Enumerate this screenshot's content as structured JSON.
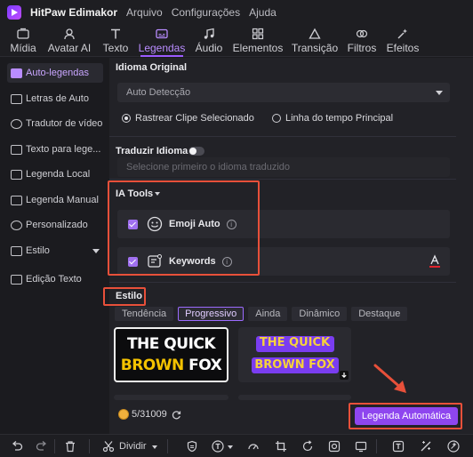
{
  "window": {
    "app_name": "HitPaw Edimakor",
    "menus": [
      "Arquivo",
      "Configurações",
      "Ajuda"
    ]
  },
  "toolbar": {
    "tools": [
      {
        "label": "Mídia",
        "icon": "media-icon",
        "active": false
      },
      {
        "label": "Avatar AI",
        "icon": "avatar-icon",
        "active": false
      },
      {
        "label": "Texto",
        "icon": "text-icon",
        "active": false
      },
      {
        "label": "Legendas",
        "icon": "subtitles-icon",
        "active": true
      },
      {
        "label": "Áudio",
        "icon": "audio-icon",
        "active": false
      },
      {
        "label": "Elementos",
        "icon": "elements-icon",
        "active": false
      },
      {
        "label": "Transição",
        "icon": "transition-icon",
        "active": false
      },
      {
        "label": "Filtros",
        "icon": "filters-icon",
        "active": false
      },
      {
        "label": "Efeitos",
        "icon": "effects-icon",
        "active": false
      }
    ]
  },
  "sidebar": {
    "items": [
      {
        "label": "Auto-legendas",
        "active": true
      },
      {
        "label": "Letras de Auto",
        "active": false
      },
      {
        "label": "Tradutor de vídeo",
        "active": false
      },
      {
        "label": "Texto para lege...",
        "active": false
      },
      {
        "label": "Legenda Local",
        "active": false
      },
      {
        "label": "Legenda Manual",
        "active": false
      },
      {
        "label": "Personalizado",
        "active": false
      },
      {
        "label": "Estilo",
        "active": false
      },
      {
        "label": "Edição Texto",
        "active": false
      }
    ]
  },
  "panel": {
    "idioma_original": {
      "title": "Idioma Original",
      "select_value": "Auto Detecção",
      "radio_options": [
        {
          "label": "Rastrear Clipe Selecionado",
          "selected": true
        },
        {
          "label": "Linha do tempo Principal",
          "selected": false
        }
      ]
    },
    "traduzir": {
      "title": "Traduzir Idioma",
      "toggle_on": false,
      "placeholder": "Selecione primeiro o idioma traduzido"
    },
    "ia_tools": {
      "title": "IA Tools",
      "items": [
        {
          "label": "Emoji Auto",
          "checked": true
        },
        {
          "label": "Keywords",
          "checked": true
        }
      ],
      "info_glyph": "i"
    },
    "estilo": {
      "title": "Estilo",
      "tabs": [
        "Tendência",
        "Progressivo",
        "Ainda",
        "Dinâmico",
        "Destaque"
      ],
      "active_tab": "Progressivo",
      "thumbnails": [
        {
          "line1": "THE QUICK",
          "line2_a": "BROWN",
          "line2_b": "FOX",
          "selected": true
        },
        {
          "line1": "THE QUICK",
          "line2": "BROWN FOX",
          "selected": false
        }
      ]
    },
    "credits": "5/31009",
    "auto_button": "Legenda Automática"
  },
  "bottom": {
    "split_label": "Dividir"
  },
  "colors": {
    "accent": "#9c5bff",
    "button": "#8e46ef",
    "annotation": "#e8503a",
    "highlight_yellow": "#f4c200"
  }
}
